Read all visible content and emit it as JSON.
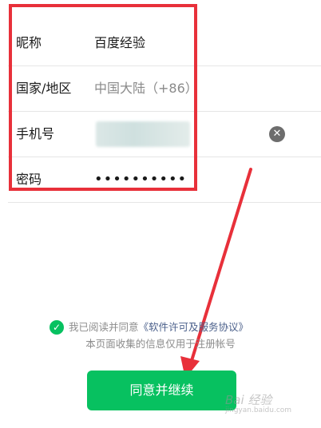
{
  "form": {
    "nickname_label": "昵称",
    "nickname_value": "百度经验",
    "region_label": "国家/地区",
    "region_value": "中国大陆（+86）",
    "phone_label": "手机号",
    "password_label": "密码",
    "password_value": "••••••••••"
  },
  "agreement": {
    "prefix": "我已阅读并同意",
    "link": "《软件许可及服务协议》",
    "notice": "本页面收集的信息仅用于注册帐号"
  },
  "actions": {
    "submit_label": "同意并继续"
  },
  "watermark": {
    "text": "Bai 经验",
    "subtext": "jingyan.baidu.com"
  },
  "colors": {
    "accent": "#07c160",
    "highlight": "#e8303a",
    "link": "#4a5f8a"
  }
}
